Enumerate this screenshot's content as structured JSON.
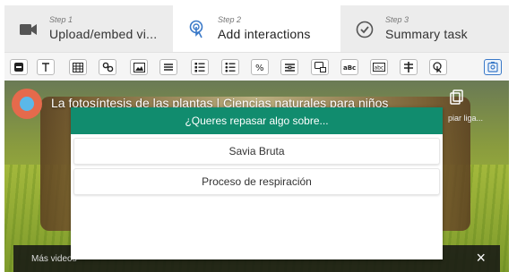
{
  "steps": [
    {
      "num": "Step 1",
      "label": "Upload/embed vi...",
      "icon": "video-camera-icon"
    },
    {
      "num": "Step 2",
      "label": "Add interactions",
      "icon": "pointer-hand-icon"
    },
    {
      "num": "Step 3",
      "label": "Summary task",
      "icon": "check-circle-icon"
    }
  ],
  "toolbar": {
    "tools": [
      "label-icon",
      "text-icon",
      "table-icon",
      "link-icon",
      "image-icon",
      "statements-icon",
      "single-choice-icon",
      "multiple-choice-icon",
      "true-false-icon",
      "fill-blanks-icon",
      "drag-drop-icon",
      "mark-words-icon",
      "drag-text-icon",
      "crossroads-icon",
      "navigation-hotspot-icon",
      "interaction-icon"
    ]
  },
  "video": {
    "title": "La fotosíntesis de las plantas | Ciencias naturales para niños",
    "copy_label": "piar liga...",
    "more_videos": "Más videos",
    "close": "×"
  },
  "dialog": {
    "header": "¿Queres repasar algo sobre...",
    "options": [
      "Savia Bruta",
      "Proceso de respiración"
    ]
  },
  "colors": {
    "accent": "#118c6e",
    "active_border": "#3a79c8"
  }
}
